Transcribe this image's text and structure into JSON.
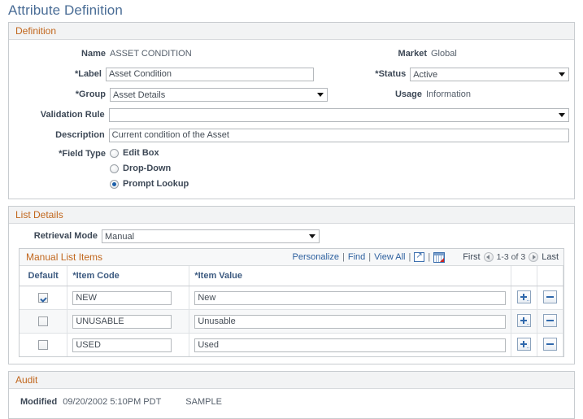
{
  "page": {
    "title": "Attribute Definition"
  },
  "definition": {
    "header": "Definition",
    "name_label": "Name",
    "name_value": "ASSET CONDITION",
    "market_label": "Market",
    "market_value": "Global",
    "label_label": "*Label",
    "label_value": "Asset Condition",
    "status_label": "*Status",
    "status_value": "Active",
    "group_label": "*Group",
    "group_value": "Asset Details",
    "usage_label": "Usage",
    "usage_value": "Information",
    "validation_rule_label": "Validation Rule",
    "validation_rule_value": "",
    "description_label": "Description",
    "description_value": "Current condition of the Asset",
    "field_type_label": "*Field Type",
    "field_type_options": [
      {
        "label": "Edit Box",
        "selected": false
      },
      {
        "label": "Drop-Down",
        "selected": false
      },
      {
        "label": "Prompt Lookup",
        "selected": true
      }
    ]
  },
  "list_details": {
    "header": "List Details",
    "retrieval_mode_label": "Retrieval Mode",
    "retrieval_mode_value": "Manual",
    "grid": {
      "title": "Manual List Items",
      "actions": {
        "personalize": "Personalize",
        "find": "Find",
        "view_all": "View All",
        "sep": "|",
        "zoom_icon": "expand-window-icon",
        "download_icon": "download-to-excel-icon"
      },
      "nav": {
        "first": "First",
        "prev_icon": "previous-page-icon",
        "range": "1-3 of 3",
        "next_icon": "next-page-icon",
        "last": "Last"
      },
      "columns": [
        "Default",
        "*Item Code",
        "*Item Value"
      ],
      "rows": [
        {
          "default": true,
          "item_code": "NEW",
          "item_value": "New"
        },
        {
          "default": false,
          "item_code": "UNUSABLE",
          "item_value": "Unusable"
        },
        {
          "default": false,
          "item_code": "USED",
          "item_value": "Used"
        }
      ],
      "add_button": "+",
      "remove_button": "−"
    }
  },
  "audit": {
    "header": "Audit",
    "modified_label": "Modified",
    "modified_value": "09/20/2002  5:10PM PDT",
    "modified_user": "SAMPLE"
  },
  "colors": {
    "title": "#4a6d96",
    "section_header_text": "#c1661c",
    "label_text": "#3d4856",
    "link": "#2c5f9e",
    "accent_blue": "#2f68ac"
  }
}
